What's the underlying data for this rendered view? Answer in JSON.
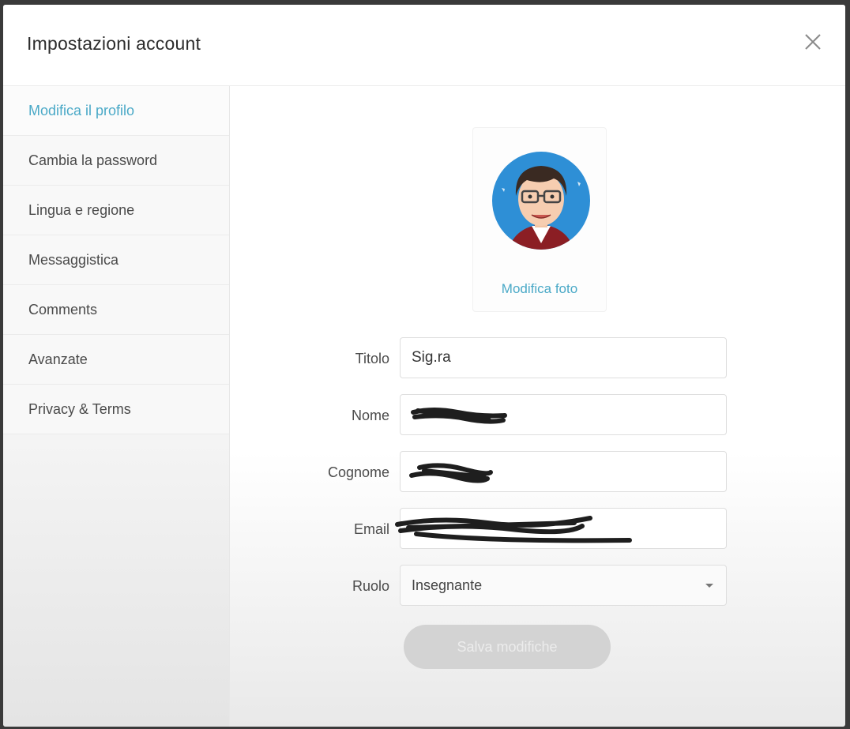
{
  "dialog": {
    "title": "Impostazioni account"
  },
  "sidebar": {
    "items": [
      {
        "label": "Modifica il profilo",
        "active": true
      },
      {
        "label": "Cambia la password",
        "active": false
      },
      {
        "label": "Lingua e regione",
        "active": false
      },
      {
        "label": "Messaggistica",
        "active": false
      },
      {
        "label": "Comments",
        "active": false
      },
      {
        "label": "Avanzate",
        "active": false
      },
      {
        "label": "Privacy & Terms",
        "active": false
      }
    ]
  },
  "profile": {
    "avatar_icon": "cartoon-avatar-icon",
    "edit_photo_label": "Modifica foto",
    "fields": {
      "title_label": "Titolo",
      "title_value": "Sig.ra",
      "first_name_label": "Nome",
      "last_name_label": "Cognome",
      "email_label": "Email",
      "role_label": "Ruolo",
      "role_value": "Insegnante"
    },
    "save_label": "Salva modifiche"
  },
  "colors": {
    "accent": "#4aa9c7",
    "disabled_button": "#d3d3d3"
  }
}
